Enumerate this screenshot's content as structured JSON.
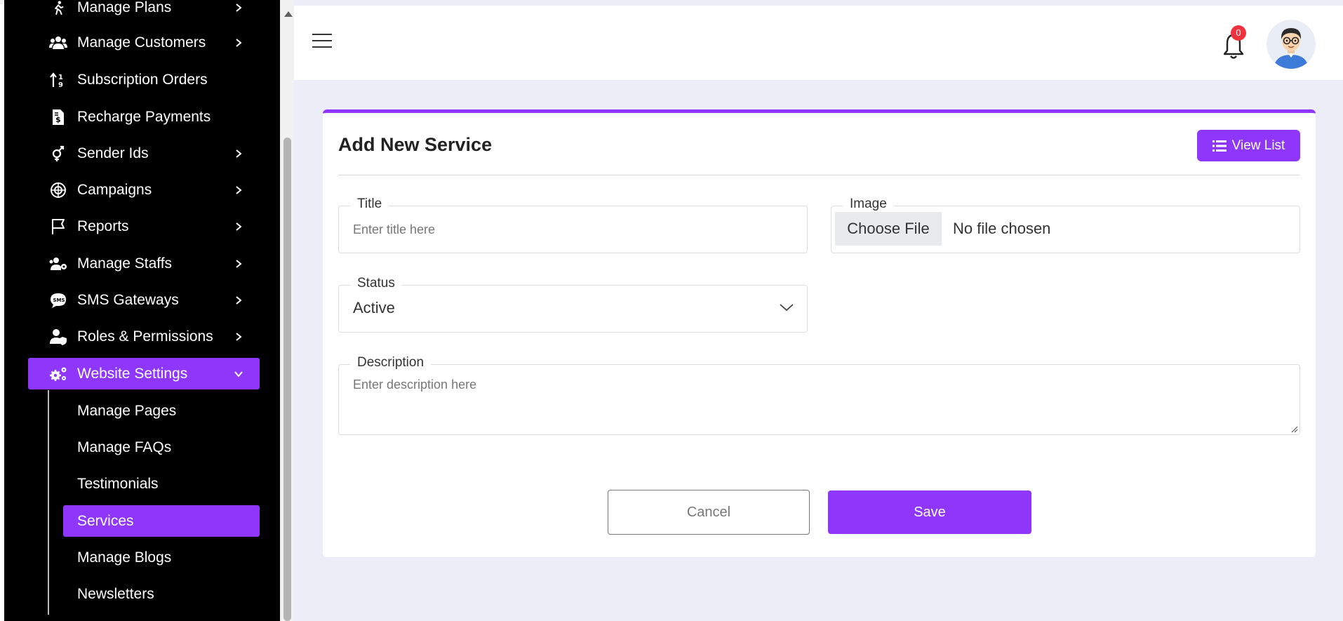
{
  "sidebar": {
    "items": [
      {
        "label": "Manage Plans",
        "icon": "plans-icon",
        "has_chevron": true
      },
      {
        "label": "Manage Customers",
        "icon": "customers-icon",
        "has_chevron": true
      },
      {
        "label": "Subscription Orders",
        "icon": "orders-icon",
        "has_chevron": false
      },
      {
        "label": "Recharge Payments",
        "icon": "invoice-icon",
        "has_chevron": false
      },
      {
        "label": "Sender Ids",
        "icon": "sender-icon",
        "has_chevron": true
      },
      {
        "label": "Campaigns",
        "icon": "campaign-icon",
        "has_chevron": true
      },
      {
        "label": "Reports",
        "icon": "flag-icon",
        "has_chevron": true
      },
      {
        "label": "Manage Staffs",
        "icon": "staffs-icon",
        "has_chevron": true
      },
      {
        "label": "SMS Gateways",
        "icon": "sms-icon",
        "has_chevron": true
      },
      {
        "label": "Roles & Permissions",
        "icon": "user-shield-icon",
        "has_chevron": true
      },
      {
        "label": "Website Settings",
        "icon": "cogs-icon",
        "has_chevron": true,
        "expanded": true,
        "active": true
      }
    ],
    "submenu": [
      {
        "label": "Manage Pages"
      },
      {
        "label": "Manage FAQs"
      },
      {
        "label": "Testimonials"
      },
      {
        "label": "Services",
        "active": true
      },
      {
        "label": "Manage Blogs"
      },
      {
        "label": "Newsletters"
      }
    ]
  },
  "header": {
    "notification_count": "0"
  },
  "form": {
    "title": "Add New Service",
    "view_list_label": "View List",
    "title_field": {
      "label": "Title",
      "placeholder": "Enter title here"
    },
    "image_field": {
      "label": "Image",
      "button_label": "Choose File",
      "file_status": "No file chosen"
    },
    "status_field": {
      "label": "Status",
      "value": "Active"
    },
    "description_field": {
      "label": "Description",
      "placeholder": "Enter description here"
    },
    "cancel_label": "Cancel",
    "save_label": "Save"
  },
  "colors": {
    "accent": "#8e37fb",
    "sidebar_bg": "#000000",
    "page_bg": "#ecedf6",
    "badge": "#f0323e"
  }
}
